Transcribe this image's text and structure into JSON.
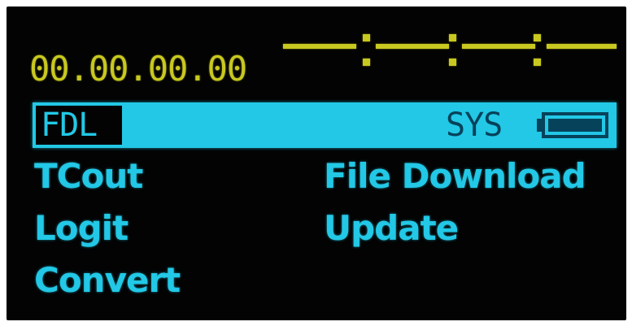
{
  "display": {
    "timecode": "00.00.00.00",
    "indicator_dashes": "——:——:——:——"
  },
  "topbar": {
    "active_tab": "FDL",
    "status_label": "SYS",
    "battery_icon": "battery-icon"
  },
  "menu": {
    "left": [
      "TCout",
      "Logit",
      "Convert"
    ],
    "right": [
      "File Download",
      "Update"
    ]
  },
  "colors": {
    "yellow": "#c8c820",
    "cyan": "#22c8e6",
    "dark_text_on_cyan": "#06425a",
    "background": "#030303"
  }
}
